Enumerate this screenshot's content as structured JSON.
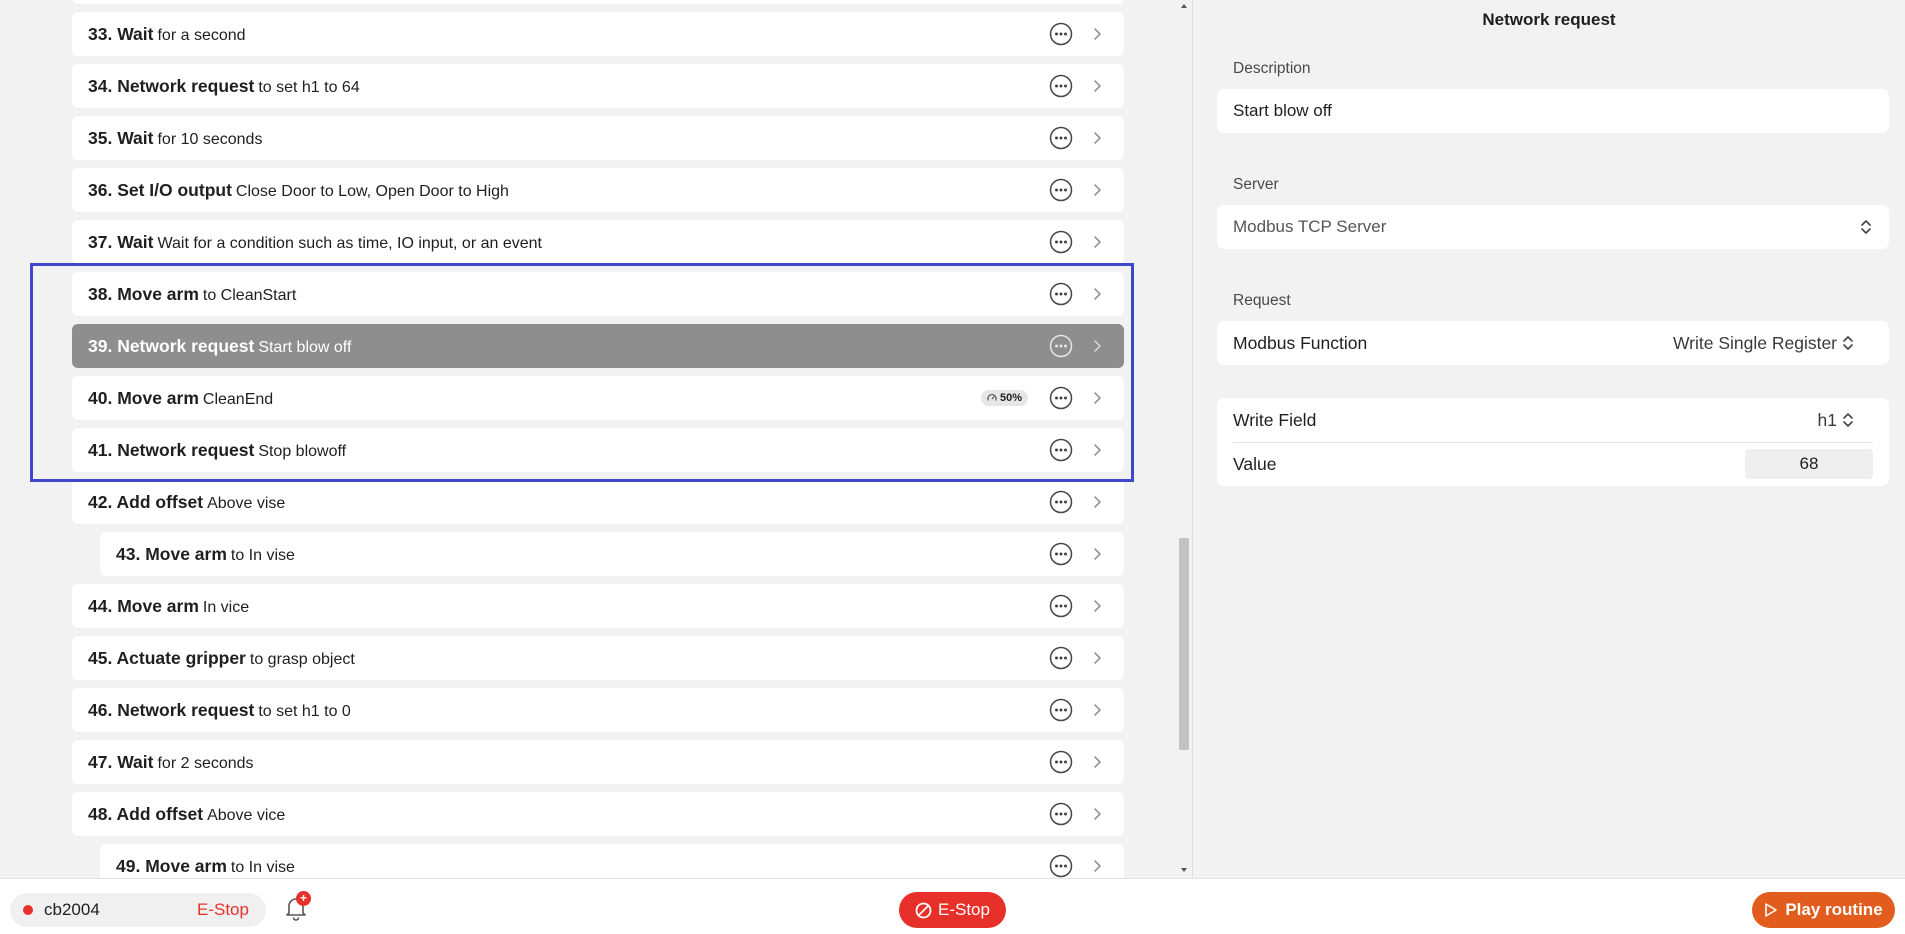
{
  "steps": [
    {
      "num": "",
      "title": "",
      "desc": "",
      "indent": false,
      "selected": false,
      "badge": ""
    },
    {
      "num": "33.",
      "title": "Wait",
      "desc": "for a second",
      "indent": false,
      "selected": false,
      "badge": ""
    },
    {
      "num": "34.",
      "title": "Network request",
      "desc": "to set h1 to 64",
      "indent": false,
      "selected": false,
      "badge": ""
    },
    {
      "num": "35.",
      "title": "Wait",
      "desc": "for 10 seconds",
      "indent": false,
      "selected": false,
      "badge": ""
    },
    {
      "num": "36.",
      "title": "Set I/O output",
      "desc": "Close Door to Low, Open Door to High",
      "indent": false,
      "selected": false,
      "badge": ""
    },
    {
      "num": "37.",
      "title": "Wait",
      "desc": "Wait for a condition such as time, IO input, or an event",
      "indent": false,
      "selected": false,
      "badge": ""
    },
    {
      "num": "38.",
      "title": "Move arm",
      "desc": "to CleanStart",
      "indent": false,
      "selected": false,
      "badge": ""
    },
    {
      "num": "39.",
      "title": "Network request",
      "desc": "Start blow off",
      "indent": false,
      "selected": true,
      "badge": ""
    },
    {
      "num": "40.",
      "title": "Move arm",
      "desc": "CleanEnd",
      "indent": false,
      "selected": false,
      "badge": "50%"
    },
    {
      "num": "41.",
      "title": "Network request",
      "desc": "Stop blowoff",
      "indent": false,
      "selected": false,
      "badge": ""
    },
    {
      "num": "42.",
      "title": "Add offset",
      "desc": "Above vise",
      "indent": false,
      "selected": false,
      "badge": ""
    },
    {
      "num": "43.",
      "title": "Move arm",
      "desc": "to In vise",
      "indent": true,
      "selected": false,
      "badge": ""
    },
    {
      "num": "44.",
      "title": "Move arm",
      "desc": "In vice",
      "indent": false,
      "selected": false,
      "badge": ""
    },
    {
      "num": "45.",
      "title": "Actuate gripper",
      "desc": "to grasp object",
      "indent": false,
      "selected": false,
      "badge": ""
    },
    {
      "num": "46.",
      "title": "Network request",
      "desc": "to set h1 to 0",
      "indent": false,
      "selected": false,
      "badge": ""
    },
    {
      "num": "47.",
      "title": "Wait",
      "desc": "for 2 seconds",
      "indent": false,
      "selected": false,
      "badge": ""
    },
    {
      "num": "48.",
      "title": "Add offset",
      "desc": "Above vice",
      "indent": false,
      "selected": false,
      "badge": ""
    },
    {
      "num": "49.",
      "title": "Move arm",
      "desc": "to In vise",
      "indent": true,
      "selected": false,
      "badge": ""
    }
  ],
  "panel": {
    "title": "Network request",
    "description_label": "Description",
    "description_value": "Start blow off",
    "server_label": "Server",
    "server_value": "Modbus TCP Server",
    "request_label": "Request",
    "modbus_function_label": "Modbus Function",
    "modbus_function_value": "Write Single Register",
    "write_field_label": "Write Field",
    "write_field_value": "h1",
    "value_label": "Value",
    "value_value": "68"
  },
  "bottom": {
    "robot_name": "cb2004",
    "robot_estop_label": "E-Stop",
    "notification_count": "+",
    "estop_button_label": "E-Stop",
    "play_button_label": "Play routine"
  },
  "colors": {
    "highlight_border": "#3f48cc",
    "selected_row": "#8e8e8e",
    "estop_red": "#e8302a",
    "play_orange": "#e25d1d"
  }
}
